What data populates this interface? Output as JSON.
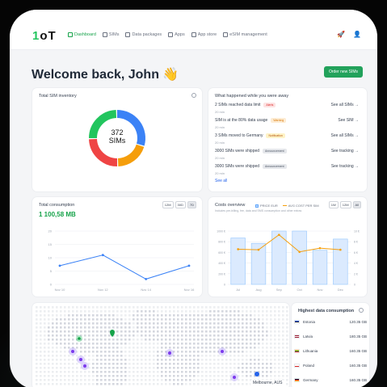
{
  "brand": {
    "logo_prefix": "1",
    "logo_suffix": "oT"
  },
  "nav": [
    {
      "label": "Dashboard",
      "icon": "home-icon",
      "active": true
    },
    {
      "label": "SIMs",
      "icon": "sim-icon"
    },
    {
      "label": "Data packages",
      "icon": "package-icon"
    },
    {
      "label": "Apps",
      "icon": "apps-icon"
    },
    {
      "label": "App store",
      "icon": "store-icon"
    },
    {
      "label": "eSIM management",
      "icon": "esim-icon"
    }
  ],
  "greeting": "Welcome back, John 👋",
  "order_button": "Order new SIMs",
  "inventory": {
    "title": "Total SIM inventory",
    "count": "372",
    "unit": "SIMs",
    "segments": [
      {
        "value": 30,
        "color": "#3b82f6"
      },
      {
        "value": 20,
        "color": "#f59e0b"
      },
      {
        "value": 25,
        "color": "#ef4444"
      },
      {
        "value": 25,
        "color": "#22c55e"
      }
    ]
  },
  "events": {
    "title": "What happened while you were away",
    "see_all": "See all",
    "items": [
      {
        "text": "2 SIMs reached data limit",
        "badge": "Alerts",
        "badge_bg": "#fde2e2",
        "badge_fg": "#dc2626",
        "date": "20 min",
        "link": "See all SIMs →"
      },
      {
        "text": "SIM is at the 80% data usage",
        "badge": "Warning",
        "badge_bg": "#fdecd3",
        "badge_fg": "#d97706",
        "date": "20 min",
        "link": "See SIM →"
      },
      {
        "text": "3 SIMs moved to Germany",
        "badge": "Notification",
        "badge_bg": "#fef3c7",
        "badge_fg": "#b45309",
        "date": "20 min",
        "link": "See all SIMs →"
      },
      {
        "text": "3000 SIMs were shipped",
        "badge": "Announcement",
        "badge_bg": "#e5e7eb",
        "badge_fg": "#4b5563",
        "date": "20 min",
        "link": "See tracking →"
      },
      {
        "text": "3000 SIMs were shipped",
        "badge": "Announcement",
        "badge_bg": "#e5e7eb",
        "badge_fg": "#4b5563",
        "date": "20 min",
        "link": "See tracking →"
      }
    ]
  },
  "consumption": {
    "title": "Total consumption",
    "total": "1 100,58 MB",
    "ranges": [
      "12M",
      "30D",
      "7D"
    ],
    "selected": "7D"
  },
  "costs": {
    "title": "Costs overview",
    "caption": "Includes pre-billing, fee, data and SMS consumption and other extras",
    "legend": [
      "PRICE EUR",
      "AVG COST PER SIM"
    ],
    "ranges": [
      "1W",
      "12M",
      "All"
    ],
    "selected": "All"
  },
  "chart_data": [
    {
      "type": "line",
      "title": "Total consumption",
      "categories": [
        "Nov 10",
        "Nov 12",
        "Nov 14",
        "Nov 16"
      ],
      "x": [
        0,
        1,
        2,
        3
      ],
      "y": [
        7,
        11,
        2,
        7
      ],
      "ylim": [
        0,
        20
      ],
      "yticks": [
        0,
        5,
        10,
        15,
        20
      ],
      "grid": true
    },
    {
      "type": "bar",
      "title": "Costs overview",
      "categories": [
        "Jul",
        "Aug",
        "Sep",
        "Oct",
        "Nov",
        "Dec"
      ],
      "series": [
        {
          "name": "PRICE EUR",
          "kind": "bar",
          "values": [
            870,
            770,
            1000,
            1000,
            640,
            850
          ],
          "axis": "left"
        },
        {
          "name": "AVG COST PER SIM",
          "kind": "line",
          "values": [
            6.6,
            6.5,
            9.3,
            6.1,
            6.8,
            6.5
          ],
          "axis": "right"
        }
      ],
      "ylim": [
        0,
        1000
      ],
      "yticks_left": [
        "0",
        "200 €",
        "400 €",
        "600 €",
        "800 €",
        "1000 €"
      ],
      "y2lim": [
        0,
        10
      ],
      "yticks_right": [
        "0",
        "2 €",
        "4 €",
        "6 €",
        "8 €",
        "10 €"
      ]
    }
  ],
  "map": {
    "label": "Melbourne, AUS"
  },
  "countries": {
    "title": "Highest data consumption",
    "items": [
      {
        "name": "Estonia",
        "value": "120.35 GB",
        "colors": [
          "#2563eb",
          "#111827",
          "#ffffff"
        ]
      },
      {
        "name": "Latvia",
        "value": "180.35 GB",
        "colors": [
          "#9e1b32",
          "#ffffff",
          "#9e1b32"
        ]
      },
      {
        "name": "Lithuania",
        "value": "160.35 GB",
        "colors": [
          "#fbbf24",
          "#16a34a",
          "#dc2626"
        ]
      },
      {
        "name": "Poland",
        "value": "160.35 GB",
        "colors": [
          "#ffffff",
          "#ffffff",
          "#dc2626"
        ]
      },
      {
        "name": "Germany",
        "value": "160.35 GB",
        "colors": [
          "#111827",
          "#dc2626",
          "#fbbf24"
        ]
      }
    ]
  }
}
